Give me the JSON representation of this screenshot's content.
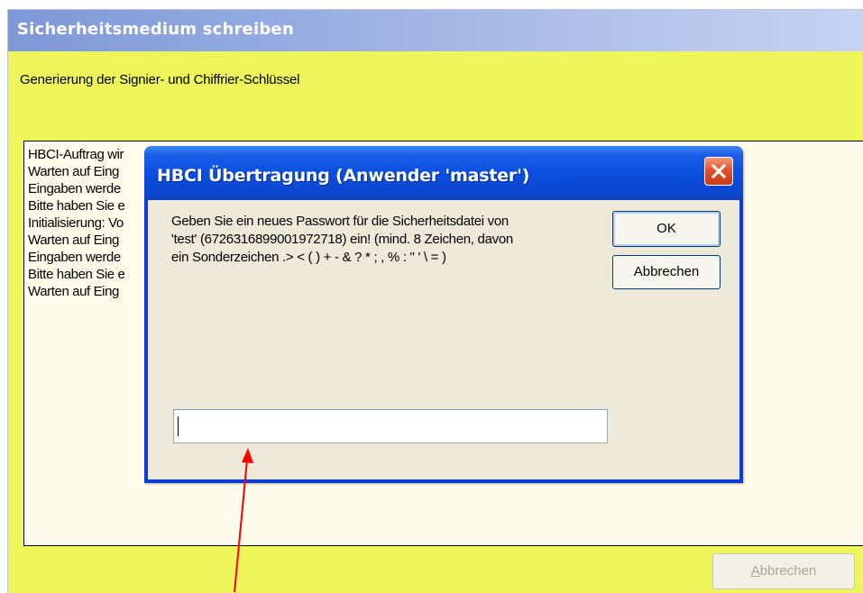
{
  "main_window": {
    "title": "Sicherheitsmedium schreiben",
    "subtitle": "Generierung der Signier- und Chiffrier-Schlüssel",
    "log_lines": [
      "HBCI-Auftrag wir",
      "Warten auf Eing",
      "Eingaben werde",
      "Bitte haben Sie e",
      "Initialisierung: Vo",
      "Warten auf Eing",
      "Eingaben werde",
      "Bitte haben Sie e",
      "Warten auf Eing"
    ],
    "cancel_label_underlined": "A",
    "cancel_label_rest": "bbrechen",
    "colors": {
      "background": "#eef55a",
      "log_background": "#fffbea"
    }
  },
  "dialog": {
    "title": "HBCI Übertragung (Anwender 'master')",
    "prompt_lines": [
      "Geben Sie ein neues Passwort für die Sicherheitsdatei von",
      "'test' (6726316899001972718) ein! (mind. 8 Zeichen, davon",
      "ein Sonderzeichen .> < ( ) + - & ? * ; , % : \" ' \\ = )"
    ],
    "ok_label": "OK",
    "cancel_label": "Abbrechen",
    "password_value": "",
    "close_icon": "close-icon",
    "colors": {
      "titlebar": "#0b4fe0",
      "body": "#ece9d8",
      "close": "#e2532a"
    }
  },
  "annotation": {
    "arrow_color": "#ff0000"
  }
}
